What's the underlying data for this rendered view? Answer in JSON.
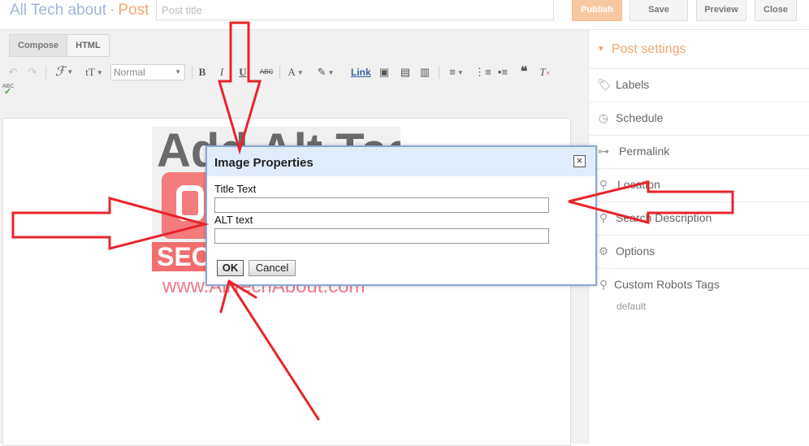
{
  "header": {
    "blog_name": "All Tech about",
    "separator": "·",
    "section": "Post",
    "title_placeholder": "Post title",
    "buttons": {
      "publish": "Publish",
      "save": "Save",
      "preview": "Preview",
      "close": "Close"
    }
  },
  "editor": {
    "tabs": [
      "Compose",
      "HTML"
    ],
    "active_tab": "Compose",
    "format_select": "Normal",
    "link_label": "Link",
    "spellcheck_label": "ABC",
    "toolbar_icons": [
      "undo-icon",
      "redo-icon",
      "font-icon",
      "font-size-icon",
      "bold-icon",
      "italic-icon",
      "underline-icon",
      "strikethrough-icon",
      "text-color-icon",
      "highlight-icon",
      "insert-image-icon",
      "insert-video-icon",
      "insert-jump-break-icon",
      "align-icon",
      "numbered-list-icon",
      "bullet-list-icon",
      "quote-icon",
      "remove-formatting-icon",
      "spellcheck-icon"
    ]
  },
  "content_image": {
    "title_text": "Add Alt Tag",
    "badge_text": "SEO",
    "url_text": "www.AllTechAbout.com"
  },
  "sidebar": {
    "header": "Post settings",
    "items": [
      {
        "label": "Labels",
        "icon": "tag-icon"
      },
      {
        "label": "Schedule",
        "icon": "clock-icon"
      },
      {
        "label": "Permalink",
        "icon": "link-icon"
      },
      {
        "label": "Location",
        "icon": "location-pin-icon"
      },
      {
        "label": "Search Description",
        "icon": "search-icon"
      },
      {
        "label": "Options",
        "icon": "gear-icon"
      },
      {
        "label": "Custom Robots Tags",
        "icon": "search-icon"
      }
    ],
    "robots_default": "default"
  },
  "dialog": {
    "title": "Image Properties",
    "title_text_label": "Title Text",
    "title_text_value": "",
    "alt_text_label": "ALT text",
    "alt_text_value": "",
    "ok_label": "OK",
    "cancel_label": "Cancel"
  },
  "colors": {
    "brand": "#9fb5d8",
    "accent": "#f3a673",
    "publish_bg": "#f8c9a0",
    "dialog_border": "#8aa8d8",
    "dialog_header": "#e1ecfb",
    "annotation_arrow": "#e8242c"
  }
}
